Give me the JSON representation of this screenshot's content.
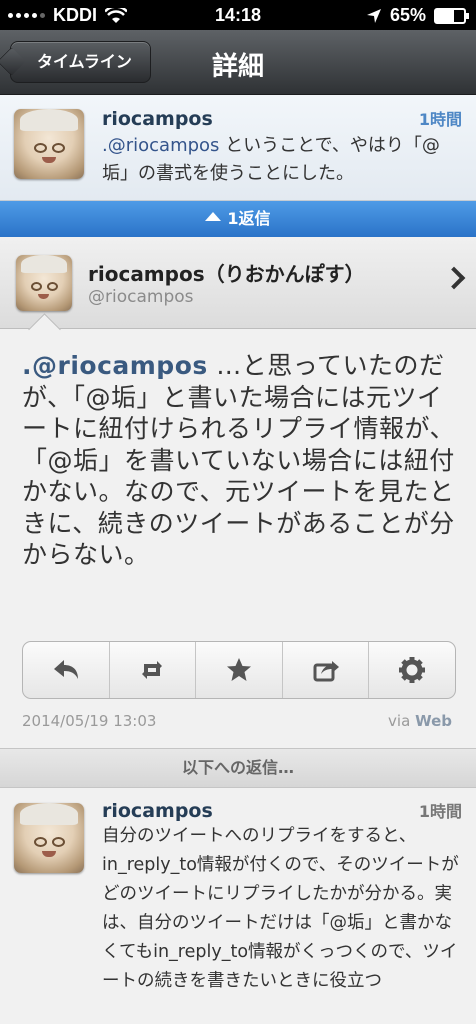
{
  "status_bar": {
    "carrier": "KDDI",
    "time": "14:18",
    "battery": "65%",
    "battery_level": 0.65
  },
  "nav": {
    "back_label": "タイムライン",
    "title": "詳細"
  },
  "parent_tweet": {
    "user": "riocampos",
    "time": "1時間",
    "mention": ".@riocampos",
    "text": " ということで、やはり「@垢」の書式を使うことにした。"
  },
  "reply_bar": {
    "label": "1返信"
  },
  "author": {
    "name": "riocampos（りおかんぽす）",
    "handle": "@riocampos"
  },
  "main_tweet": {
    "mention": ".@riocampos",
    "text": " …と思っていたのだが、「@垢」と書いた場合には元ツイートに紐付けられるリプライ情報が、「@垢」を書いていない場合には紐付かない。なので、元ツイートを見たときに、続きのツイートがあることが分からない。",
    "date": "2014/05/19 13:03",
    "via_prefix": "via",
    "via_source": "Web"
  },
  "actions": [
    {
      "name": "reply-icon"
    },
    {
      "name": "retweet-icon"
    },
    {
      "name": "star-icon"
    },
    {
      "name": "share-icon"
    },
    {
      "name": "gear-icon"
    }
  ],
  "replies_header": "以下への返信…",
  "reply": {
    "user": "riocampos",
    "time": "1時間",
    "text": "自分のツイートへのリプライをすると、in_reply_to情報が付くので、そのツイートがどのツイートにリプライしたかが分かる。実は、自分のツイートだけは「@垢」と書かなくてもin_reply_to情報がくっつくので、ツイートの続きを書きたいときに役立つ"
  },
  "colors": {
    "reply_bar": "#2f7fd6",
    "mention": "#3a5a80",
    "nav_bar": "#3b3e41"
  }
}
